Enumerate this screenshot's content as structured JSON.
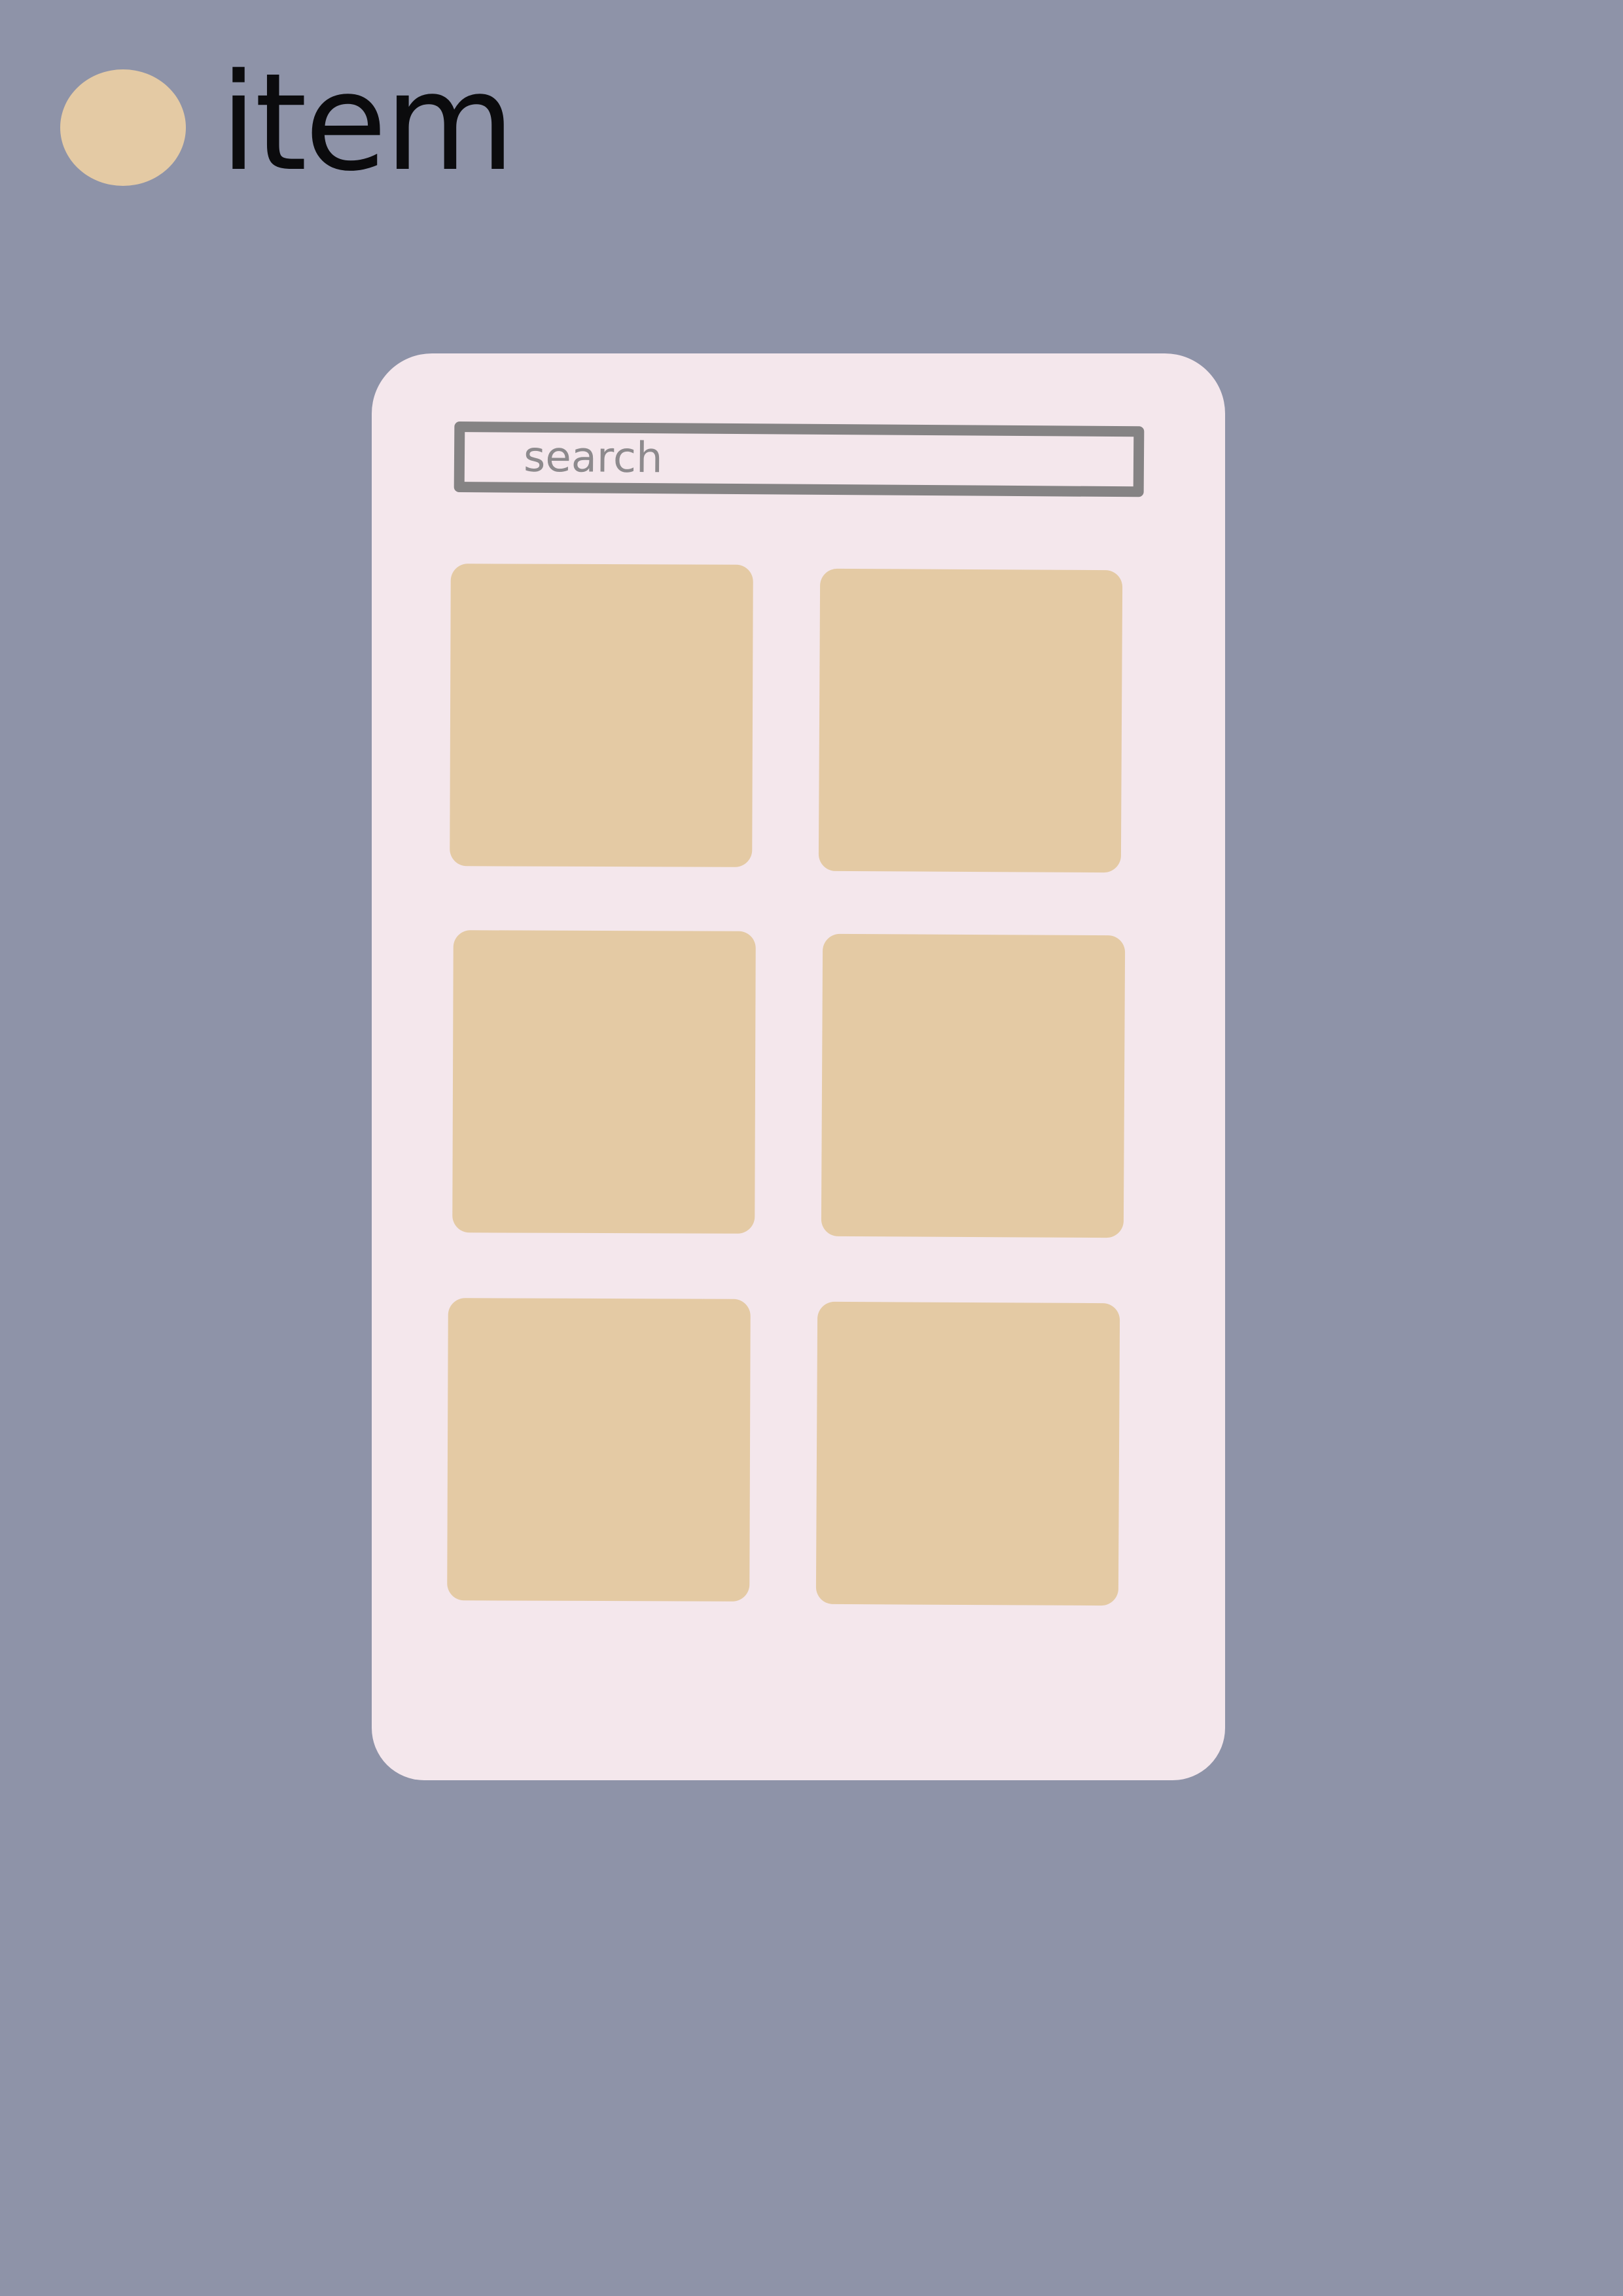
{
  "header": {
    "label": "item",
    "dot_icon": "circle-icon",
    "dot_color": "#e4caa4"
  },
  "search": {
    "placeholder": "search"
  },
  "grid": {
    "rows": 3,
    "columns": 2,
    "card_color": "#e4caa4",
    "items": [
      {
        "id": "card-1"
      },
      {
        "id": "card-2"
      },
      {
        "id": "card-3"
      },
      {
        "id": "card-4"
      },
      {
        "id": "card-5"
      },
      {
        "id": "card-6"
      }
    ]
  },
  "colors": {
    "background": "#8e93a8",
    "phone": "#f4e7ec",
    "search_border": "#858384",
    "search_text": "#8d8a8d",
    "header_text": "#0b0b0d"
  }
}
